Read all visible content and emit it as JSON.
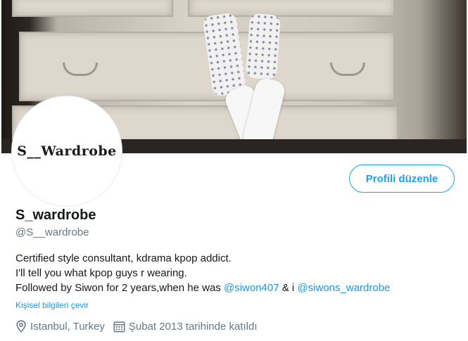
{
  "profile": {
    "avatar_text": "S__Wardrobe",
    "edit_button_label": "Profili düzenle",
    "name": "S_wardrobe",
    "handle": "@S__wardrobe",
    "bio": {
      "line1": "Certified style consultant, kdrama kpop addict.",
      "line2": "I'll tell you what kpop guys r wearing.",
      "line3_prefix": "Followed by Siwon for 2 years,when he was ",
      "mention1": "@siwon407",
      "line3_middle": " & i ",
      "mention2": "@siwons_wardrobe"
    },
    "translate_link": "Kişisel bilgileri çevir",
    "location": "Istanbul, Turkey",
    "joined": "Şubat 2013 tarihinde katıldı"
  },
  "icons": {
    "location": "location-pin-icon",
    "calendar": "calendar-icon"
  },
  "colors": {
    "accent": "#1da1f2",
    "link": "#1b95e0",
    "secondary_text": "#657786",
    "primary_text": "#14171a"
  }
}
